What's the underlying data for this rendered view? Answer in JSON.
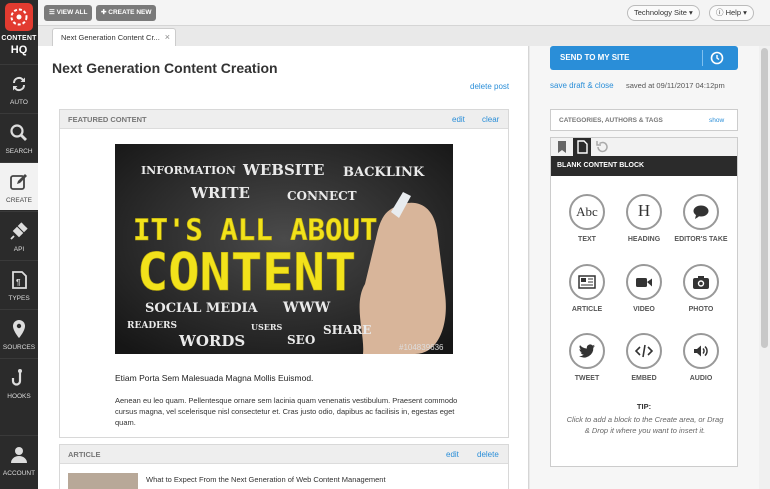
{
  "app": {
    "logo_line1": "CONTENT",
    "logo_line2": "HQ"
  },
  "sidebar": {
    "items": [
      {
        "label": "AUTO",
        "icon": "sync-icon"
      },
      {
        "label": "SEARCH",
        "icon": "search-icon"
      },
      {
        "label": "CREATE",
        "icon": "edit-icon"
      },
      {
        "label": "API",
        "icon": "plug-icon"
      },
      {
        "label": "TYPES",
        "icon": "document-type-icon"
      },
      {
        "label": "SOURCES",
        "icon": "map-pin-icon"
      },
      {
        "label": "HOOKS",
        "icon": "hook-icon"
      },
      {
        "label": "ACCOUNT",
        "icon": "user-icon"
      }
    ]
  },
  "toolbar": {
    "view_all": "VIEW ALL",
    "create_new": "CREATE NEW",
    "site_select": "Technology Site",
    "help": "Help"
  },
  "tab": {
    "label": "Next Generation Content Cr..."
  },
  "post": {
    "title": "Next Generation Content Creation",
    "delete_post": "delete post"
  },
  "featured": {
    "heading": "FEATURED CONTENT",
    "edit": "edit",
    "clear": "clear",
    "image_words": {
      "information": "INFORMATION",
      "website": "WEBSITE",
      "backlink": "BACKLINK",
      "write": "WRITE",
      "connect": "CONNECT",
      "headline1": "IT'S ALL ABOUT",
      "headline2": "CONTENT",
      "social_media": "SOCIAL MEDIA",
      "www": "WWW",
      "readers": "READERS",
      "users": "USERS",
      "share": "SHARE",
      "words": "WORDS",
      "seo": "SEO",
      "stock_id": "#104839636"
    },
    "subheading": "Etiam Porta Sem Malesuada Magna Mollis Euismod.",
    "paragraph": "Aenean eu leo quam. Pellentesque ornare sem lacinia quam venenatis vestibulum. Praesent commodo cursus magna, vel scelerisque nisl consectetur et. Cras justo odio, dapibus ac facilisis in, egestas eget quam."
  },
  "article": {
    "heading": "ARTICLE",
    "edit": "edit",
    "delete": "delete",
    "title": "What to Expect From the Next Generation of Web Content Management"
  },
  "right": {
    "send": "SEND TO MY SITE",
    "save_close": "save draft & close",
    "saved_at": "saved at 09/11/2017 04:12pm",
    "categories": "CATEGORIES, AUTHORS & TAGS",
    "show": "show",
    "block_title": "BLANK CONTENT BLOCK",
    "blocks": [
      {
        "label": "TEXT",
        "icon": "text-abc-icon"
      },
      {
        "label": "HEADING",
        "icon": "heading-h-icon"
      },
      {
        "label": "EDITOR'S TAKE",
        "icon": "speech-bubble-icon"
      },
      {
        "label": "ARTICLE",
        "icon": "newspaper-icon"
      },
      {
        "label": "VIDEO",
        "icon": "video-camera-icon"
      },
      {
        "label": "PHOTO",
        "icon": "camera-icon"
      },
      {
        "label": "TWEET",
        "icon": "twitter-bird-icon"
      },
      {
        "label": "EMBED",
        "icon": "code-icon"
      },
      {
        "label": "AUDIO",
        "icon": "speaker-icon"
      }
    ],
    "tip_title": "TIP:",
    "tip_body": "Click to add a block to the Create area, or Drag & Drop it where you want to insert it."
  },
  "colors": {
    "accent": "#2a8ed8",
    "sidebar": "#2b2b2b",
    "logo": "#e23b30",
    "headline_yellow": "#f2e21b"
  }
}
